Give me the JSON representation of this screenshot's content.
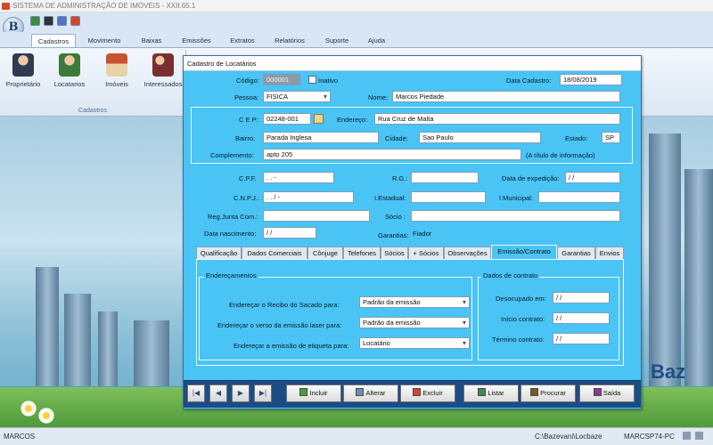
{
  "app": {
    "title": "SISTEMA DE ADMINISTRAÇÃO DE IMÓVEIS - XXII.65.1",
    "logo_letter": "B"
  },
  "menu": [
    "Cadastros",
    "Movimento",
    "Baixas",
    "Emissões",
    "Extratos",
    "Relatórios",
    "Suporte",
    "Ajuda"
  ],
  "ribbon": {
    "buttons": [
      "Proprietário",
      "Locatarios",
      "Imóveis",
      "Interessados"
    ],
    "group": "Cadastros"
  },
  "dialog": {
    "title": "Cadastro de Locatários",
    "codigo_label": "Código:",
    "codigo": "000001",
    "inativo_label": "Inativo",
    "data_cadastro_label": "Data Cadastro:",
    "data_cadastro": "18/08/2019",
    "pessoa_label": "Pessoa:",
    "pessoa": "FISICA",
    "nome_label": "Nome:",
    "nome": "Marcos Piedade",
    "cep_label": "C E P:",
    "cep": "02248-001",
    "endereco_label": "Endereço:",
    "endereco": "Rua Cruz de Malta",
    "bairro_label": "Bairro:",
    "bairro": "Parada Inglesa",
    "cidade_label": "Cidade:",
    "cidade": "Sao Paulo",
    "estado_label": "Estado:",
    "estado": "SP",
    "complemento_label": "Complemento:",
    "complemento": "apto 205",
    "complemento_hint": "(A título de informação)",
    "cpf_label": "C.P.F.",
    "cpf": " .  .  -",
    "rg_label": "R.G.:",
    "rg": "",
    "data_expedicao_label": "Data de expedição:",
    "data_expedicao": " / /",
    "cnpj_label": "C.N.P.J.:",
    "cnpj": " .  . /  -",
    "iestadual_label": "I.Estadual:",
    "iestadual": "",
    "imunicipal_label": "I.Municipal:",
    "imunicipal": "",
    "regjunta_label": "Reg.Junta Com.:",
    "regjunta": "",
    "socio_label": "Sócio :",
    "socio": "",
    "data_nasc_label": "Data nascimento:",
    "data_nasc": " / /",
    "garantias_label": "Garantias:",
    "garantias": "Fiador"
  },
  "tabs": [
    "Qualificação",
    "Dados Comerciais",
    "Cônjuge",
    "Telefones",
    "Sócios",
    "+ Sócios",
    "Observações",
    "Emissão/Contrato",
    "Garantias",
    "Envios"
  ],
  "tab_active": "Emissão/Contrato",
  "enderecamentos": {
    "title": "Endereçamentos",
    "rows": [
      {
        "label": "Endereçar o Recibo do Sacado para:",
        "value": "Padrão da emissão"
      },
      {
        "label": "Endereçar o verso da emissão laser para:",
        "value": "Padrão da emissão"
      },
      {
        "label": "Endereçar a emissão de etiqueta para:",
        "value": "Locatário"
      }
    ]
  },
  "contrato": {
    "title": "Dados de contrato",
    "rows": [
      {
        "label": "Desocupado em:",
        "value": " / /"
      },
      {
        "label": "Início contrato:",
        "value": " / /"
      },
      {
        "label": "Término contrato:",
        "value": " / /"
      }
    ]
  },
  "nav": [
    "|◀",
    "◀",
    "▶",
    "▶|"
  ],
  "actions": [
    "Incluir",
    "Alterar",
    "Excluir",
    "Listar",
    "Procurar",
    "Saída"
  ],
  "status": {
    "user": "MARCOS",
    "path": "C:\\Bazevani\\Locbaze",
    "machine": "MARCSP74-PC"
  },
  "brand": "Baz",
  "colors": {
    "dialog_bg": "#49c4f5",
    "navbar": "#1a4d86"
  }
}
